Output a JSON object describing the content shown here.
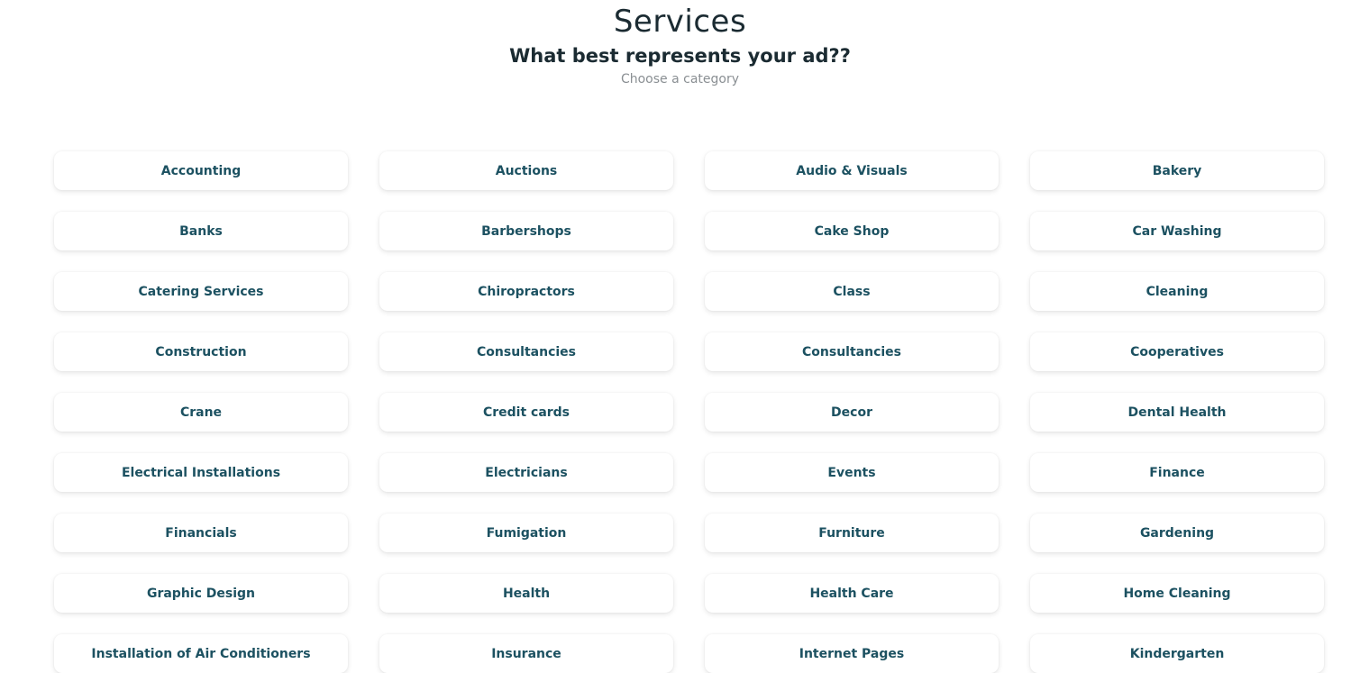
{
  "header": {
    "title": "Services",
    "subtitle": "What best represents your ad??",
    "hint": "Choose a category"
  },
  "colors": {
    "title": "#1b2b32",
    "hint": "#8a8f93",
    "category_text": "#1c5161",
    "card_bg": "#ffffff"
  },
  "categories": [
    "Accounting",
    "Auctions",
    "Audio & Visuals",
    "Bakery",
    "Banks",
    "Barbershops",
    "Cake Shop",
    "Car Washing",
    "Catering Services",
    "Chiropractors",
    "Class",
    "Cleaning",
    "Construction",
    "Consultancies",
    "Consultancies",
    "Cooperatives",
    "Crane",
    "Credit cards",
    "Decor",
    "Dental Health",
    "Electrical Installations",
    "Electricians",
    "Events",
    "Finance",
    "Financials",
    "Fumigation",
    "Furniture",
    "Gardening",
    "Graphic Design",
    "Health",
    "Health Care",
    "Home Cleaning",
    "Installation of Air Conditioners",
    "Insurance",
    "Internet Pages",
    "Kindergarten"
  ]
}
